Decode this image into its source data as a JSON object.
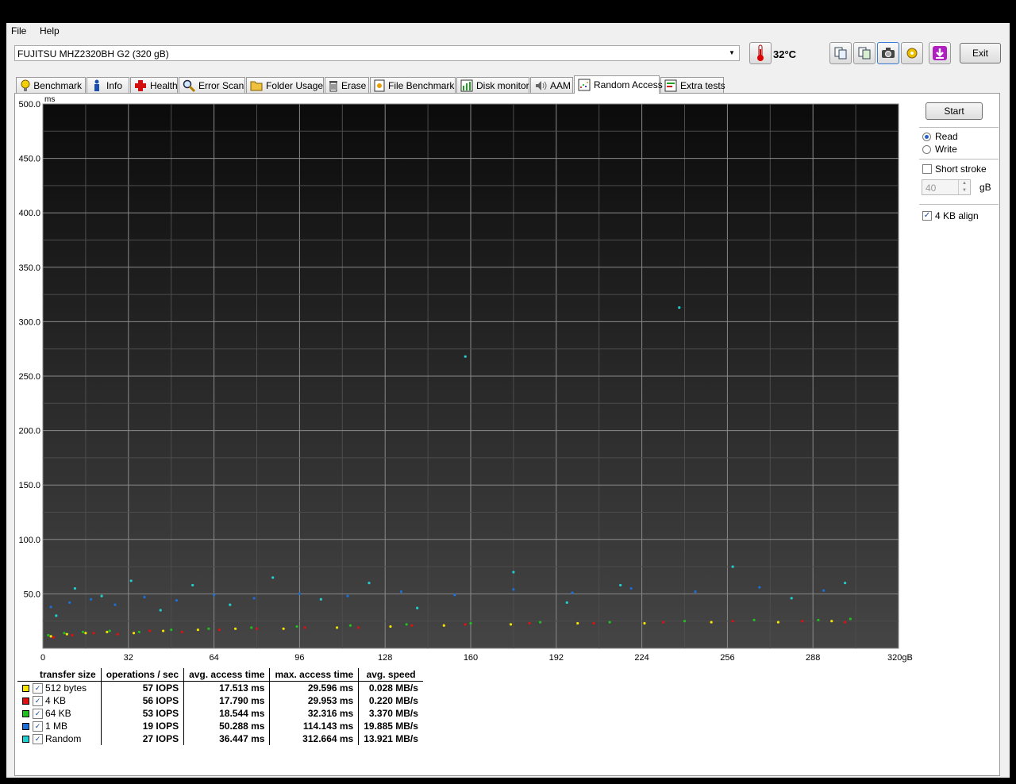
{
  "menu": {
    "file": "File",
    "help": "Help"
  },
  "drive": {
    "selected": "FUJITSU MHZ2320BH G2 (320 gB)"
  },
  "temperature": "32°C",
  "toolbar": {
    "exit_label": "Exit"
  },
  "tabs": [
    {
      "label": "Benchmark",
      "icon": "bulb-icon"
    },
    {
      "label": "Info",
      "icon": "info-icon"
    },
    {
      "label": "Health",
      "icon": "health-cross-icon"
    },
    {
      "label": "Error Scan",
      "icon": "magnifier-icon"
    },
    {
      "label": "Folder Usage",
      "icon": "folder-icon"
    },
    {
      "label": "Erase",
      "icon": "trash-icon"
    },
    {
      "label": "File Benchmark",
      "icon": "file-benchmark-icon"
    },
    {
      "label": "Disk monitor",
      "icon": "monitor-chart-icon"
    },
    {
      "label": "AAM",
      "icon": "speaker-icon"
    },
    {
      "label": "Random Access",
      "icon": "scatter-icon",
      "active": true
    },
    {
      "label": "Extra tests",
      "icon": "extra-tests-icon"
    }
  ],
  "side": {
    "start_label": "Start",
    "read_label": "Read",
    "write_label": "Write",
    "mode": "Read",
    "short_stroke_label": "Short stroke",
    "short_stroke_checked": false,
    "stroke_value": "40",
    "stroke_unit": "gB",
    "align_label": "4 KB align",
    "align_checked": true
  },
  "results": {
    "headers": [
      "transfer size",
      "operations / sec",
      "avg. access time",
      "max. access time",
      "avg. speed"
    ],
    "rows": [
      {
        "size": "512 bytes",
        "color": "#f5e400",
        "ops": "57 IOPS",
        "avg": "17.513 ms",
        "max": "29.596 ms",
        "speed": "0.028 MB/s"
      },
      {
        "size": "4 KB",
        "color": "#e01010",
        "ops": "56 IOPS",
        "avg": "17.790 ms",
        "max": "29.953 ms",
        "speed": "0.220 MB/s"
      },
      {
        "size": "64 KB",
        "color": "#20c020",
        "ops": "53 IOPS",
        "avg": "18.544 ms",
        "max": "32.316 ms",
        "speed": "3.370 MB/s"
      },
      {
        "size": "1 MB",
        "color": "#1a6fd8",
        "ops": "19 IOPS",
        "avg": "50.288 ms",
        "max": "114.143 ms",
        "speed": "19.885 MB/s"
      },
      {
        "size": "Random",
        "color": "#20d0d0",
        "ops": "27 IOPS",
        "avg": "36.447 ms",
        "max": "312.664 ms",
        "speed": "13.921 MB/s"
      }
    ]
  },
  "chart_data": {
    "type": "scatter",
    "ylabel": "ms",
    "xlabel": "gB",
    "ylim": [
      0,
      500
    ],
    "xlim": [
      0,
      320
    ],
    "y_ticks": [
      "500.0",
      "450.0",
      "400.0",
      "350.0",
      "300.0",
      "250.0",
      "200.0",
      "150.0",
      "100.0",
      "50.0"
    ],
    "y_tick_values": [
      500,
      450,
      400,
      350,
      300,
      250,
      200,
      150,
      100,
      50
    ],
    "x_ticks": [
      "0",
      "32",
      "64",
      "96",
      "128",
      "160",
      "192",
      "224",
      "256",
      "288",
      "320gB"
    ],
    "x_tick_values": [
      0,
      32,
      64,
      96,
      128,
      160,
      192,
      224,
      256,
      288,
      320
    ],
    "grid": true,
    "series": [
      {
        "name": "512 bytes",
        "color": "#f5e400",
        "values": [
          [
            3,
            11
          ],
          [
            9,
            13
          ],
          [
            16,
            14
          ],
          [
            24,
            15
          ],
          [
            34,
            14
          ],
          [
            45,
            16
          ],
          [
            58,
            17
          ],
          [
            72,
            18
          ],
          [
            90,
            18
          ],
          [
            110,
            19
          ],
          [
            130,
            20
          ],
          [
            150,
            21
          ],
          [
            175,
            22
          ],
          [
            200,
            23
          ],
          [
            225,
            23
          ],
          [
            250,
            24
          ],
          [
            275,
            24
          ],
          [
            295,
            25
          ]
        ]
      },
      {
        "name": "4 KB",
        "color": "#e01010",
        "values": [
          [
            4,
            10
          ],
          [
            11,
            12
          ],
          [
            19,
            14
          ],
          [
            28,
            13
          ],
          [
            40,
            16
          ],
          [
            52,
            15
          ],
          [
            66,
            17
          ],
          [
            80,
            18
          ],
          [
            98,
            19
          ],
          [
            118,
            19
          ],
          [
            138,
            21
          ],
          [
            158,
            22
          ],
          [
            182,
            23
          ],
          [
            206,
            23
          ],
          [
            232,
            24
          ],
          [
            258,
            25
          ],
          [
            284,
            25
          ],
          [
            300,
            24
          ]
        ]
      },
      {
        "name": "64 KB",
        "color": "#20c020",
        "values": [
          [
            2,
            12
          ],
          [
            8,
            14
          ],
          [
            15,
            15
          ],
          [
            25,
            16
          ],
          [
            36,
            15
          ],
          [
            48,
            17
          ],
          [
            62,
            18
          ],
          [
            78,
            19
          ],
          [
            95,
            20
          ],
          [
            115,
            21
          ],
          [
            136,
            22
          ],
          [
            160,
            23
          ],
          [
            186,
            24
          ],
          [
            212,
            24
          ],
          [
            240,
            25
          ],
          [
            266,
            26
          ],
          [
            290,
            26
          ],
          [
            302,
            27
          ]
        ]
      },
      {
        "name": "1 MB",
        "color": "#1a6fd8",
        "values": [
          [
            3,
            38
          ],
          [
            10,
            42
          ],
          [
            18,
            45
          ],
          [
            27,
            40
          ],
          [
            38,
            47
          ],
          [
            50,
            44
          ],
          [
            64,
            49
          ],
          [
            79,
            46
          ],
          [
            96,
            50
          ],
          [
            114,
            48
          ],
          [
            134,
            52
          ],
          [
            154,
            49
          ],
          [
            176,
            54
          ],
          [
            198,
            51
          ],
          [
            220,
            55
          ],
          [
            244,
            52
          ],
          [
            268,
            56
          ],
          [
            292,
            53
          ]
        ]
      },
      {
        "name": "Random",
        "color": "#20d0d0",
        "values": [
          [
            5,
            30
          ],
          [
            12,
            55
          ],
          [
            22,
            48
          ],
          [
            33,
            62
          ],
          [
            44,
            35
          ],
          [
            56,
            58
          ],
          [
            70,
            40
          ],
          [
            86,
            65
          ],
          [
            104,
            45
          ],
          [
            122,
            60
          ],
          [
            140,
            37
          ],
          [
            158,
            268
          ],
          [
            176,
            70
          ],
          [
            196,
            42
          ],
          [
            216,
            58
          ],
          [
            238,
            313
          ],
          [
            258,
            75
          ],
          [
            280,
            46
          ],
          [
            300,
            60
          ]
        ]
      }
    ]
  }
}
